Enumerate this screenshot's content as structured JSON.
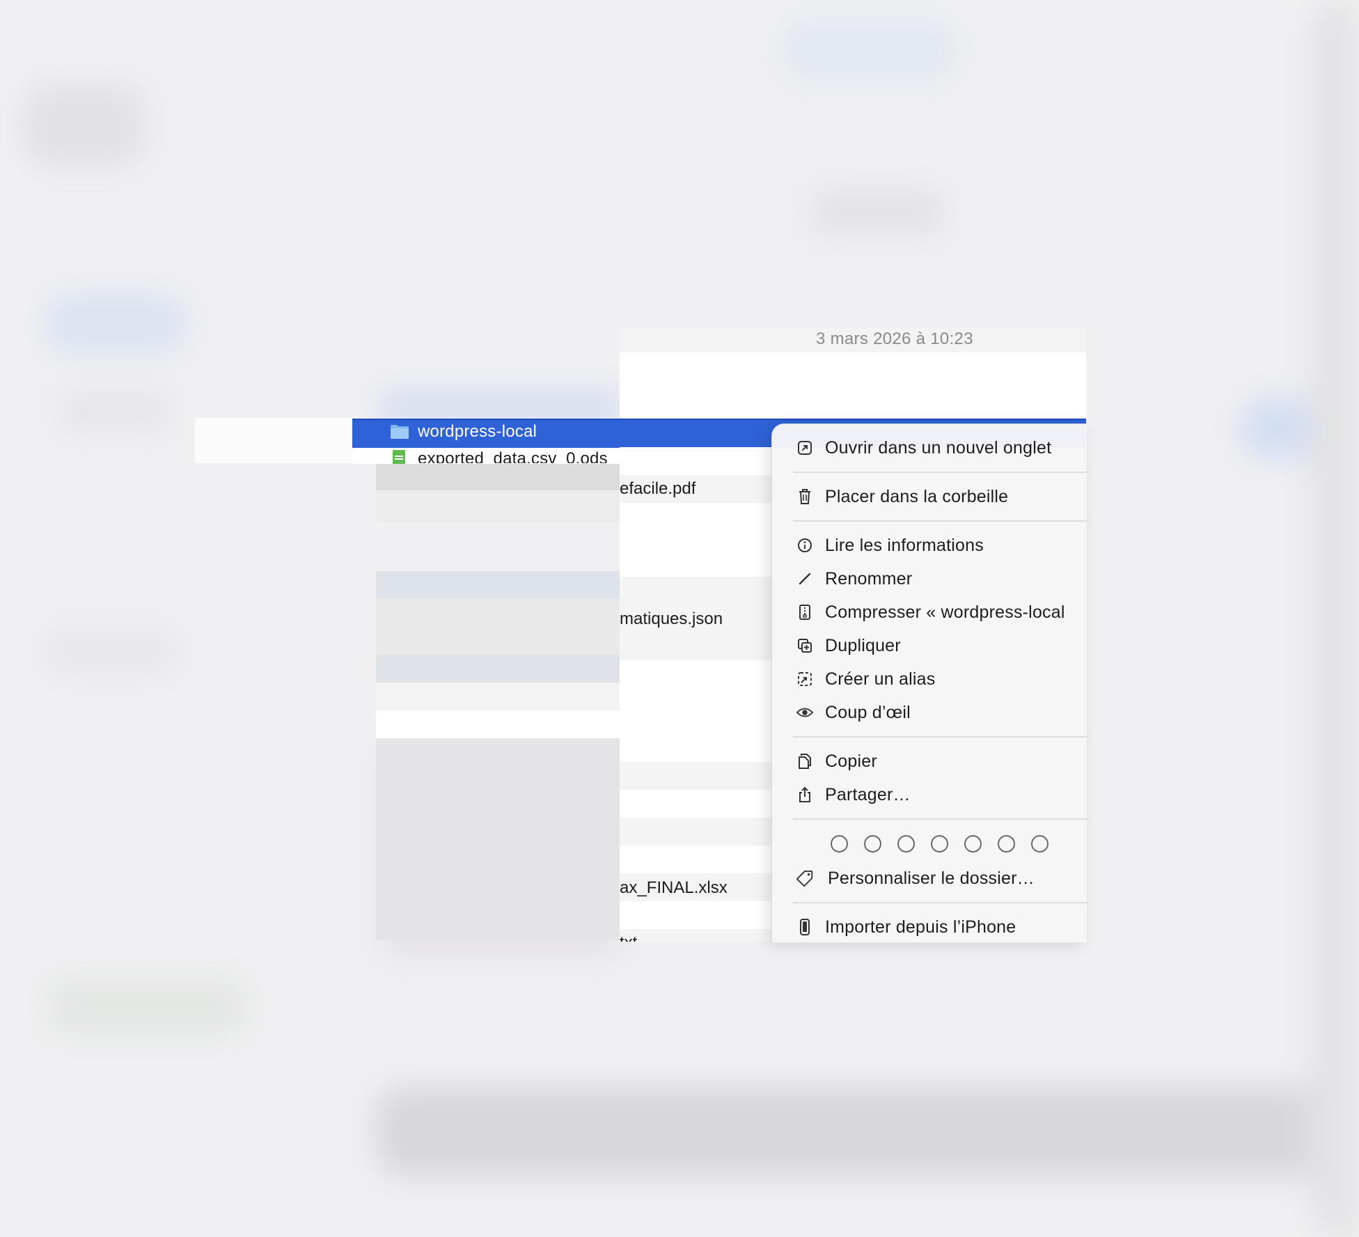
{
  "finder": {
    "date_modified": "3 mars 2026 à 10:23",
    "selected_item": "wordpress-local",
    "next_item_partial": "exported_data.csv_0.ods",
    "partial_names": [
      "efacile.pdf",
      "matiques.json",
      "ax_FINAL.xlsx",
      "txt"
    ]
  },
  "context_menu": {
    "items": [
      {
        "label": "Ouvrir dans un nouvel onglet",
        "icon": "open-in-new-tab-icon"
      },
      {
        "label": "Placer dans la corbeille",
        "icon": "trash-icon"
      },
      {
        "label": "Lire les informations",
        "icon": "info-icon"
      },
      {
        "label": "Renommer",
        "icon": "pencil-icon"
      },
      {
        "label": "Compresser « wordpress-local",
        "icon": "archive-icon"
      },
      {
        "label": "Dupliquer",
        "icon": "duplicate-icon"
      },
      {
        "label": "Créer un alias",
        "icon": "alias-icon"
      },
      {
        "label": "Coup d’œil",
        "icon": "eye-icon"
      },
      {
        "label": "Copier",
        "icon": "copy-icon"
      },
      {
        "label": "Partager…",
        "icon": "share-icon"
      },
      {
        "label": "Personnaliser le dossier…",
        "icon": "tag-icon"
      },
      {
        "label": "Importer depuis l’iPhone",
        "icon": "iphone-icon"
      }
    ],
    "tag_colors_count": 7
  },
  "colors": {
    "selection": "#2f62d6",
    "menu_bg": "#f6f6f7",
    "text": "#1d1d1f"
  }
}
